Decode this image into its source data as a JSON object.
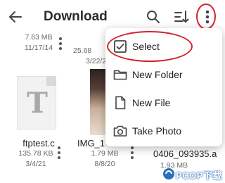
{
  "header": {
    "title": "Download",
    "back_icon": "arrow-left-icon",
    "search_icon": "search-icon",
    "sort_icon": "sort-icon",
    "more_icon": "more-vert-icon"
  },
  "files_row1": [
    {
      "size": "7.63 MB",
      "date": "11/17/14"
    },
    {
      "size": "25.68",
      "date": "3/22/2"
    }
  ],
  "files_row2": [
    {
      "name": "ftptest.c",
      "size": "135.78 KB",
      "date": "3/4/21",
      "thumb": "T"
    },
    {
      "name": "IMG_1⁢",
      "size": "1.79 MB",
      "date": "8/8/20"
    },
    {
      "name": "0406_093935.a",
      "size": "1.93 MB",
      "date": ""
    }
  ],
  "menu": {
    "items": [
      {
        "label": "Select",
        "icon": "checkbox-icon"
      },
      {
        "label": "New Folder",
        "icon": "folder-icon"
      },
      {
        "label": "New File",
        "icon": "file-icon"
      },
      {
        "label": "Take Photo",
        "icon": "camera-icon"
      }
    ]
  },
  "watermark": {
    "text": "PCOP下载"
  },
  "colors": {
    "annotation_red": "#d6212a",
    "icon_gray": "#555555"
  }
}
